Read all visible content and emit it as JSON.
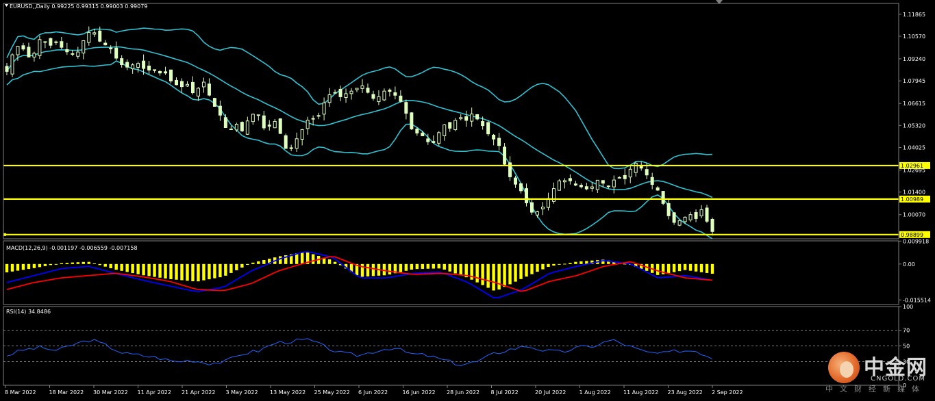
{
  "header": {
    "symbol": "EURUSD,,Daily",
    "ohlc": "0.99225 0.99315 0.99003 0.99079"
  },
  "colors": {
    "background": "#000000",
    "grid": "#5a5a5a",
    "bullish_candle": "#dfffbf",
    "bearish_candle": "#dfffbf",
    "bollinger": "#2fc2d2",
    "support_resistance": "#ffff00",
    "macd_histogram": "#ffff00",
    "macd_line": "#0000ff",
    "macd_signal": "#ff0000",
    "rsi_line": "#1e66ff",
    "axis_text": "#ffffff"
  },
  "chart_data": [
    {
      "type": "candlestick",
      "title": "EURUSD,,Daily",
      "ylim": [
        0.9865,
        1.125
      ],
      "y_ticks": [
        "1.11865",
        "1.10570",
        "1.09240",
        "1.07945",
        "1.06615",
        "1.05320",
        "1.04025",
        "1.02695",
        "1.01400",
        "1.00070"
      ],
      "x_ticks": [
        "8 Mar 2022",
        "18 Mar 2022",
        "30 Mar 2022",
        "11 Apr 2022",
        "21 Apr 2022",
        "3 May 2022",
        "13 May 2022",
        "25 May 2022",
        "6 Jun 2022",
        "16 Jun 2022",
        "28 Jun 2022",
        "8 Jul 2022",
        "20 Jul 2022",
        "1 Aug 2022",
        "11 Aug 2022",
        "23 Aug 2022",
        "2 Sep 2022"
      ],
      "horizontal_levels": [
        {
          "value": 1.02961,
          "label": "1.02961"
        },
        {
          "value": 1.00989,
          "label": "1.00989"
        },
        {
          "value": 0.98899,
          "label": "0.98899"
        }
      ],
      "close_anchors": [
        1.085,
        1.095,
        1.1,
        1.098,
        1.093,
        1.096,
        1.105,
        1.102,
        1.1,
        1.103,
        1.098,
        1.096,
        1.095,
        1.097,
        1.106,
        1.109,
        1.107,
        1.1,
        1.101,
        1.096,
        1.09,
        1.088,
        1.087,
        1.091,
        1.088,
        1.085,
        1.087,
        1.083,
        1.086,
        1.08,
        1.078,
        1.075,
        1.079,
        1.072,
        1.074,
        1.08,
        1.072,
        1.065,
        1.06,
        1.052,
        1.051,
        1.054,
        1.05,
        1.056,
        1.06,
        1.059,
        1.051,
        1.053,
        1.056,
        1.047,
        1.038,
        1.04,
        1.047,
        1.052,
        1.058,
        1.057,
        1.06,
        1.07,
        1.072,
        1.073,
        1.068,
        1.075,
        1.072,
        1.078,
        1.075,
        1.07,
        1.068,
        1.073,
        1.074,
        1.072,
        1.069,
        1.064,
        1.052,
        1.049,
        1.048,
        1.044,
        1.042,
        1.048,
        1.054,
        1.051,
        1.056,
        1.058,
        1.056,
        1.06,
        1.057,
        1.053,
        1.048,
        1.045,
        1.041,
        1.029,
        1.022,
        1.018,
        1.014,
        1.006,
        1.001,
        1.003,
        1.006,
        1.012,
        1.018,
        1.022,
        1.02,
        1.021,
        1.016,
        1.018,
        1.014,
        1.02,
        1.022,
        1.016,
        1.019,
        1.024,
        1.02,
        1.025,
        1.032,
        1.029,
        1.026,
        1.019,
        1.017,
        1.009,
        1.001,
        0.996,
        0.997,
        0.999,
        1.001,
        0.998,
        1.004,
        0.997,
        0.9908
      ]
    },
    {
      "type": "histogram+line",
      "title": "MACD(12,26,9) -0.001197 -0.006559 -0.007158",
      "ylim": [
        -0.0175,
        0.01
      ],
      "y_ticks": [
        "0.009918",
        "0.00",
        "-0.015514"
      ],
      "series": [
        {
          "name": "MACD",
          "anchors": [
            -0.008,
            -0.005,
            -0.002,
            -0.001,
            -0.004,
            -0.007,
            -0.0095,
            -0.012,
            -0.01,
            -0.003,
            0.002,
            0.0055,
            0.003,
            -0.006,
            -0.006,
            -0.004,
            -0.0035,
            -0.008,
            -0.015,
            -0.011,
            -0.004,
            -0.001,
            0.0015,
            0.0,
            -0.006,
            -0.005,
            -0.007
          ]
        },
        {
          "name": "Signal",
          "anchors": [
            -0.011,
            -0.008,
            -0.006,
            -0.005,
            -0.004,
            -0.0055,
            -0.0075,
            -0.011,
            -0.0115,
            -0.0085,
            -0.003,
            0.0005,
            0.0035,
            -0.001,
            -0.003,
            -0.0045,
            -0.004,
            -0.005,
            -0.008,
            -0.012,
            -0.0075,
            -0.005,
            -0.001,
            0.001,
            -0.003,
            -0.006,
            -0.007
          ]
        }
      ]
    },
    {
      "type": "line",
      "title": "RSI(14) 34.8486",
      "ylim": [
        0,
        100
      ],
      "y_ticks": [
        "100",
        "70",
        "50",
        "30",
        "0"
      ],
      "levels": [
        70,
        50,
        30
      ],
      "anchors": [
        38,
        45,
        48,
        44,
        52,
        58,
        50,
        40,
        38,
        35,
        30,
        32,
        28,
        30,
        40,
        44,
        54,
        56,
        58,
        48,
        40,
        38,
        44,
        48,
        40,
        38,
        32,
        26,
        30,
        40,
        46,
        50,
        44,
        42,
        48,
        50,
        58,
        50,
        42,
        40,
        44,
        44,
        34.8486
      ]
    }
  ],
  "watermark": {
    "name": "中金网",
    "site": "CNGOLD.COM",
    "tagline": "中文财经新媒体"
  }
}
